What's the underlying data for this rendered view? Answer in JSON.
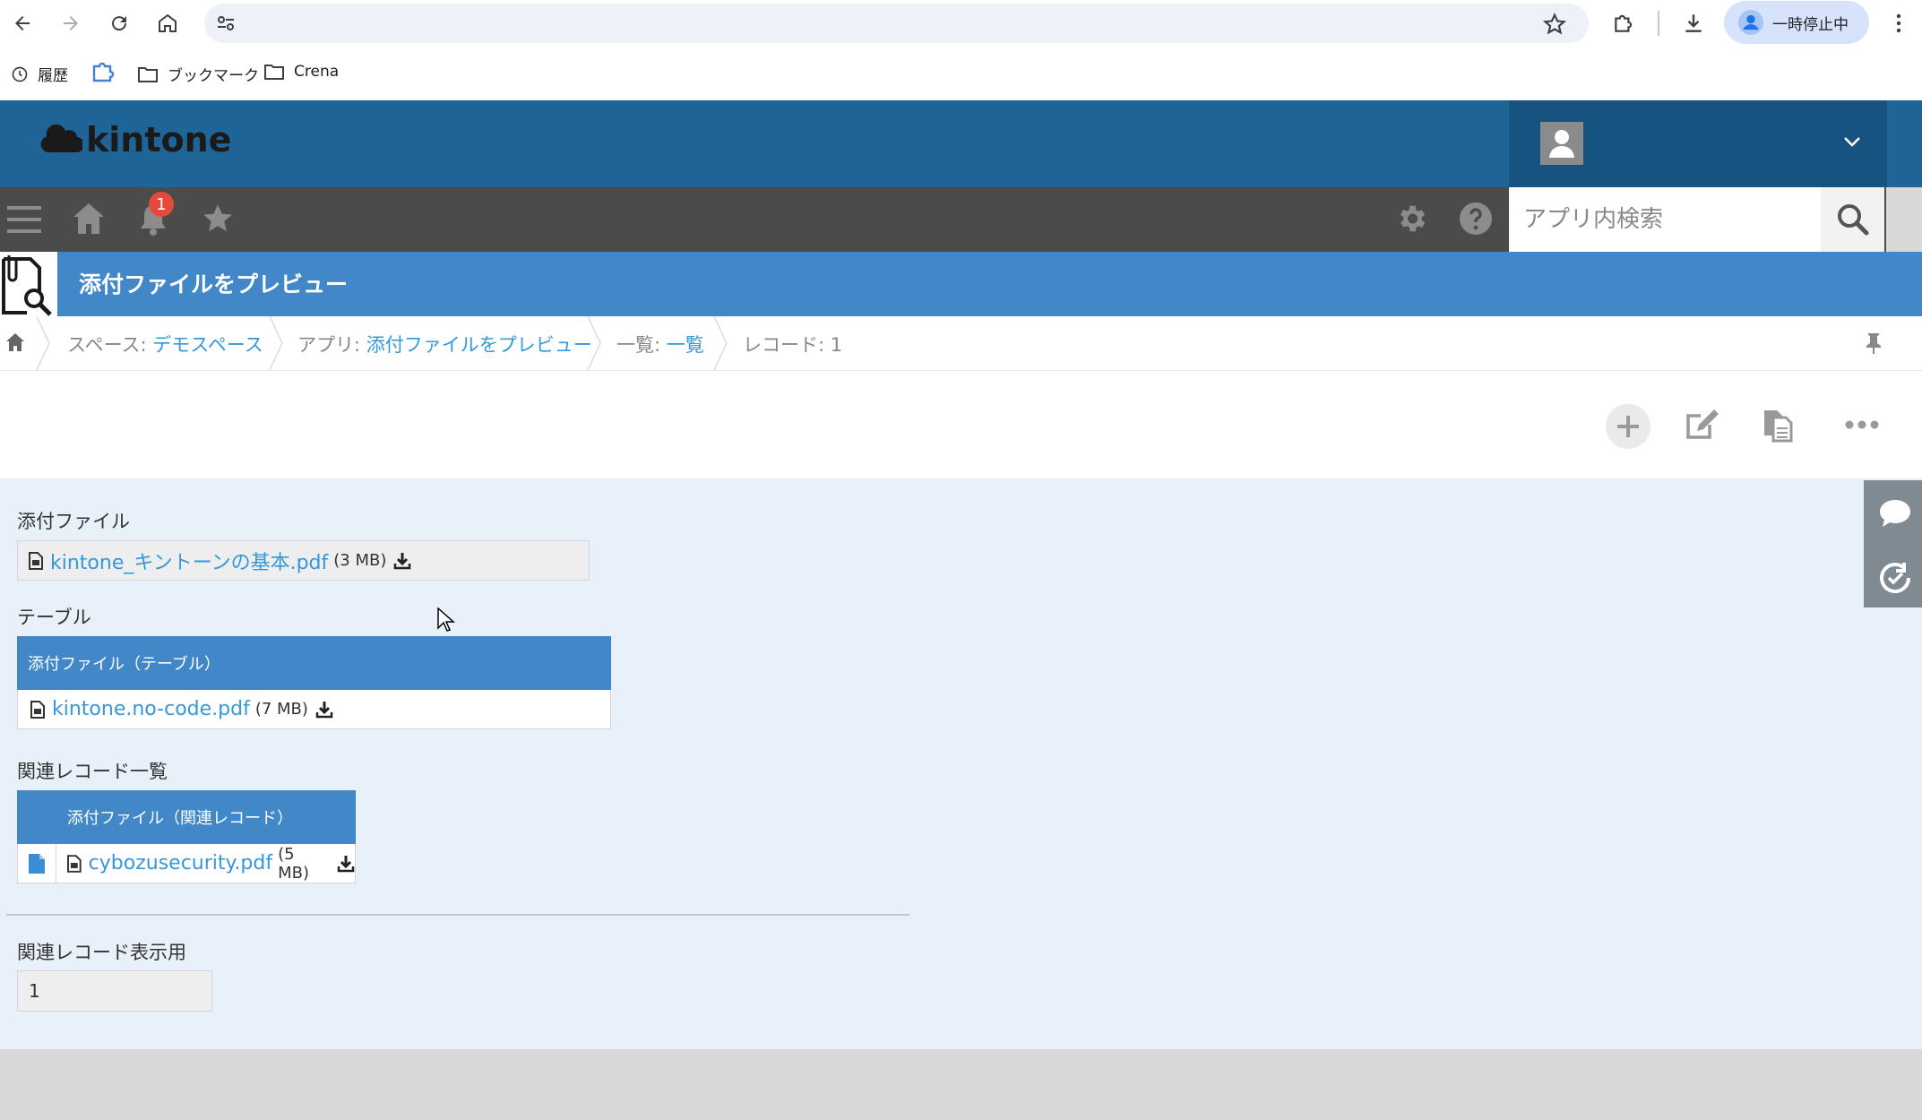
{
  "browser": {
    "profile_label": "一時停止中",
    "bookmarks": [
      {
        "label": "履歴",
        "icon": "history-icon"
      },
      {
        "label": "",
        "icon": "puzzle-app-icon"
      },
      {
        "label": "ブックマーク",
        "icon": "folder-icon"
      },
      {
        "label": "Crena",
        "icon": "folder-icon"
      }
    ]
  },
  "header": {
    "logo_text": "kintone",
    "notification_count": "1",
    "search_placeholder": "アプリ内検索"
  },
  "app": {
    "title": "添付ファイルをプレビュー"
  },
  "breadcrumb": {
    "space_prefix": "スペース:",
    "space_name": "デモスペース",
    "app_prefix": "アプリ:",
    "app_name": "添付ファイルをプレビュー",
    "view_prefix": "一覧:",
    "view_name": "一覧",
    "record": "レコード: 1"
  },
  "record": {
    "attachment_label": "添付ファイル",
    "attachment": {
      "name": "kintone_キントーンの基本.pdf",
      "size": "(3 MB)"
    },
    "table_label": "テーブル",
    "table_header": "添付ファイル（テーブル）",
    "table_file": {
      "name": "kintone.no-code.pdf",
      "size": "(7 MB)"
    },
    "related_label": "関連レコード一覧",
    "related_header": "添付ファイル（関連レコード）",
    "related_file": {
      "name": "cybozusecurity.pdf",
      "size": "(5 MB)"
    },
    "related_display_label": "関連レコード表示用",
    "related_display_value": "1"
  },
  "colors": {
    "header_bg": "#1f6497",
    "gnav_bg": "#4b4b4b",
    "title_bg": "#4288c8",
    "link": "#3498db",
    "content_bg": "#e8f0f9"
  }
}
